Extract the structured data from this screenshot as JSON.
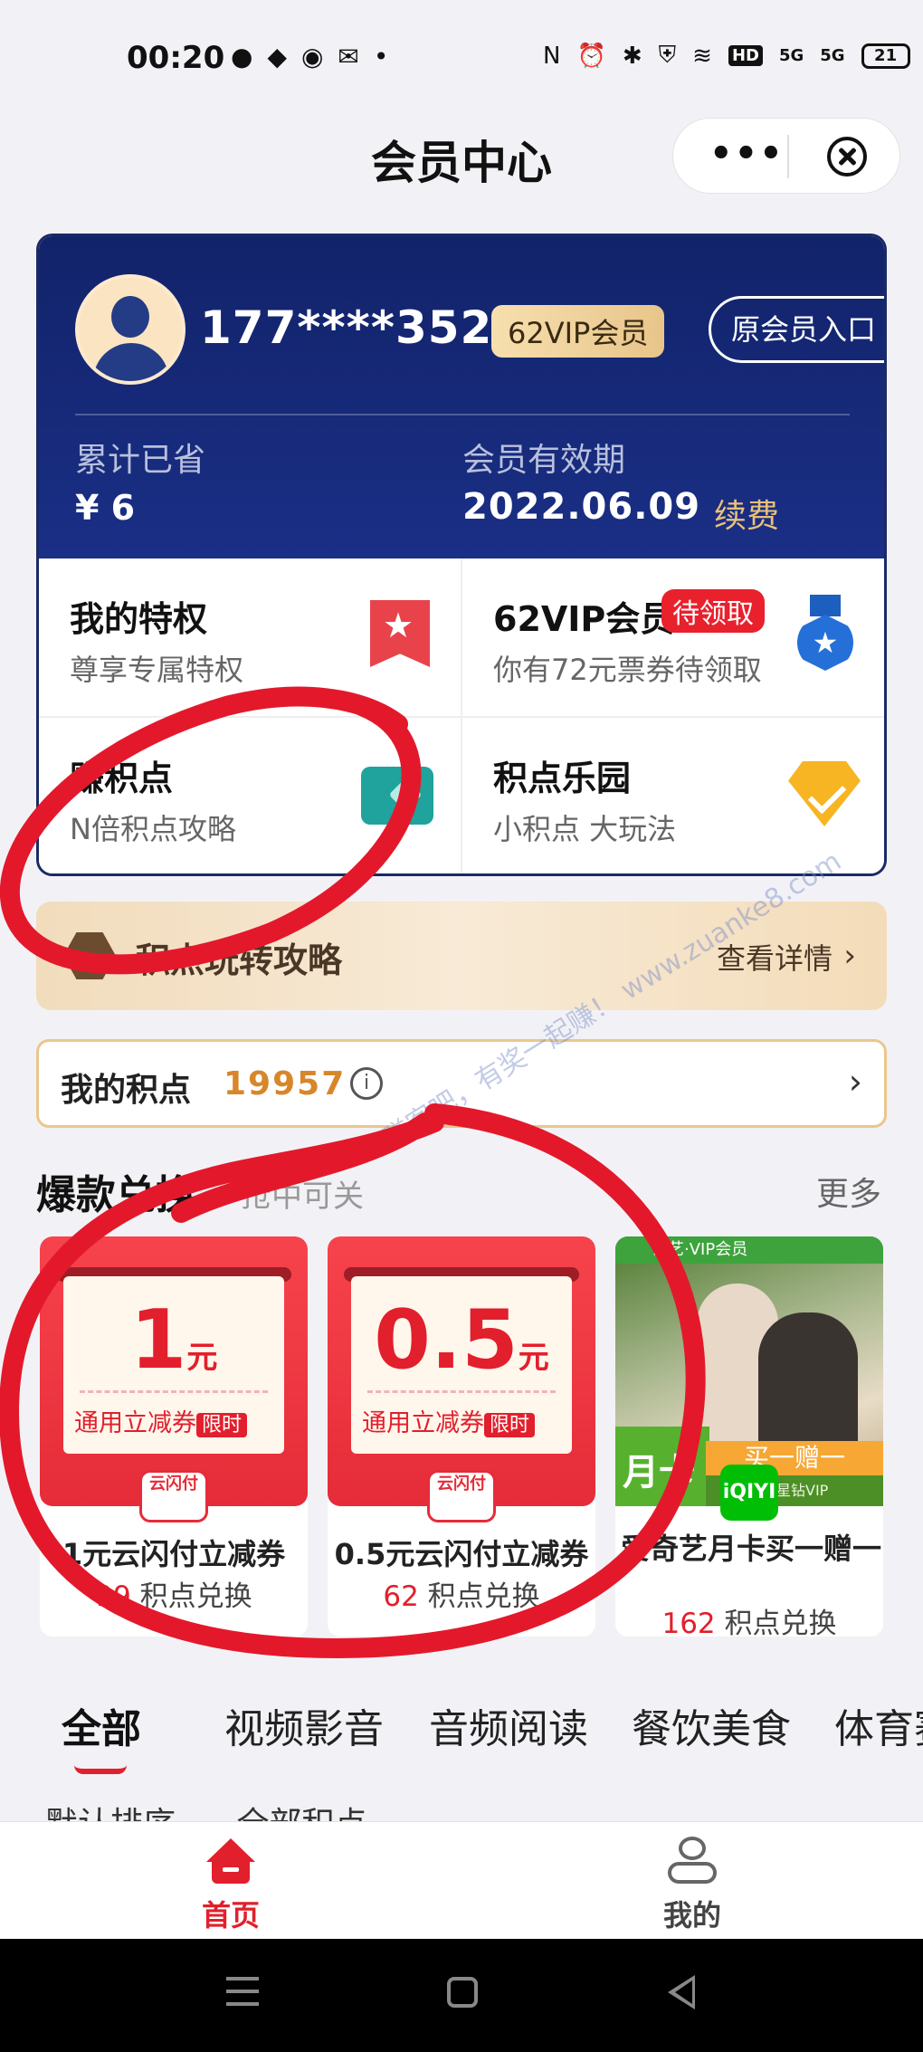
{
  "status_bar": {
    "time": "00:20",
    "left_icons": [
      "wechat-icon",
      "alipay-icon",
      "app-icon",
      "mail-icon",
      "dot-icon"
    ],
    "right_icons": [
      "nfc-icon",
      "alarm-icon",
      "bluetooth-icon",
      "shield-icon",
      "wifi-icon",
      "hd-icon",
      "signal-5g-icon",
      "signal-5g-icon"
    ],
    "hd": "HD",
    "signal1": "5G",
    "signal2": "5G",
    "battery": "21"
  },
  "header": {
    "title": "会员中心",
    "more": "•••"
  },
  "member": {
    "phone": "177****3520",
    "vip_badge": "62VIP会员",
    "old_entry": "原会员入口",
    "saved_label": "累计已省",
    "saved_value": "¥ 6",
    "valid_label": "会员有效期",
    "valid_value": "2022.06.09",
    "renew": "续费"
  },
  "grid": [
    {
      "title": "我的特权",
      "subtitle": "尊享专属特权",
      "icon": "star-bookmark-icon"
    },
    {
      "title": "62VIP会员",
      "tag": "待领取",
      "subtitle": "你有72元票券待领取",
      "icon": "medal-icon"
    },
    {
      "title": "赚积点",
      "subtitle": "N倍积点攻略",
      "icon": "ticket-icon"
    },
    {
      "title": "积点乐园",
      "subtitle": "小积点 大玩法",
      "icon": "diamond-icon"
    }
  ],
  "banner": {
    "title": "积点玩转攻略",
    "more": "查看详情"
  },
  "points": {
    "label": "我的积点",
    "value": "19957",
    "info": "i"
  },
  "hot": {
    "title": "爆款兑换",
    "subtitle": "抢中可关",
    "more": "更多"
  },
  "products": [
    {
      "amount": "1",
      "unit": "元",
      "coupon_type": "通用立减券",
      "limited": "限时",
      "name": "1元云闪付立减券",
      "points": "99",
      "points_suffix": "积点兑换",
      "logo": "云闪付"
    },
    {
      "amount": "0.5",
      "unit": "元",
      "coupon_type": "通用立减券",
      "limited": "限时",
      "name": "0.5元云闪付立减券",
      "points": "62",
      "points_suffix": "积点兑换",
      "logo": "云闪付"
    },
    {
      "tag": "奇艺·VIP会员",
      "month": "月卡",
      "buy_one": "买一赠一",
      "strip": "爱奇艺星钻VIP",
      "logo": "iQIYI",
      "name": "爱奇艺月卡买一赠一",
      "points": "162",
      "points_suffix": "积点兑换"
    }
  ],
  "categories": [
    "全部",
    "视频影音",
    "音频阅读",
    "餐饮美食",
    "体育赛事"
  ],
  "sort": {
    "order": "默认排序",
    "range": "全部积点"
  },
  "tabbar": {
    "home": "首页",
    "me": "我的"
  },
  "watermark": "赚客吧，有奖一起赚！ www.zuanke8.com",
  "colors": {
    "brand_red": "#e21f2c",
    "card_navy": "#12236a",
    "gold": "#e8c07a"
  }
}
